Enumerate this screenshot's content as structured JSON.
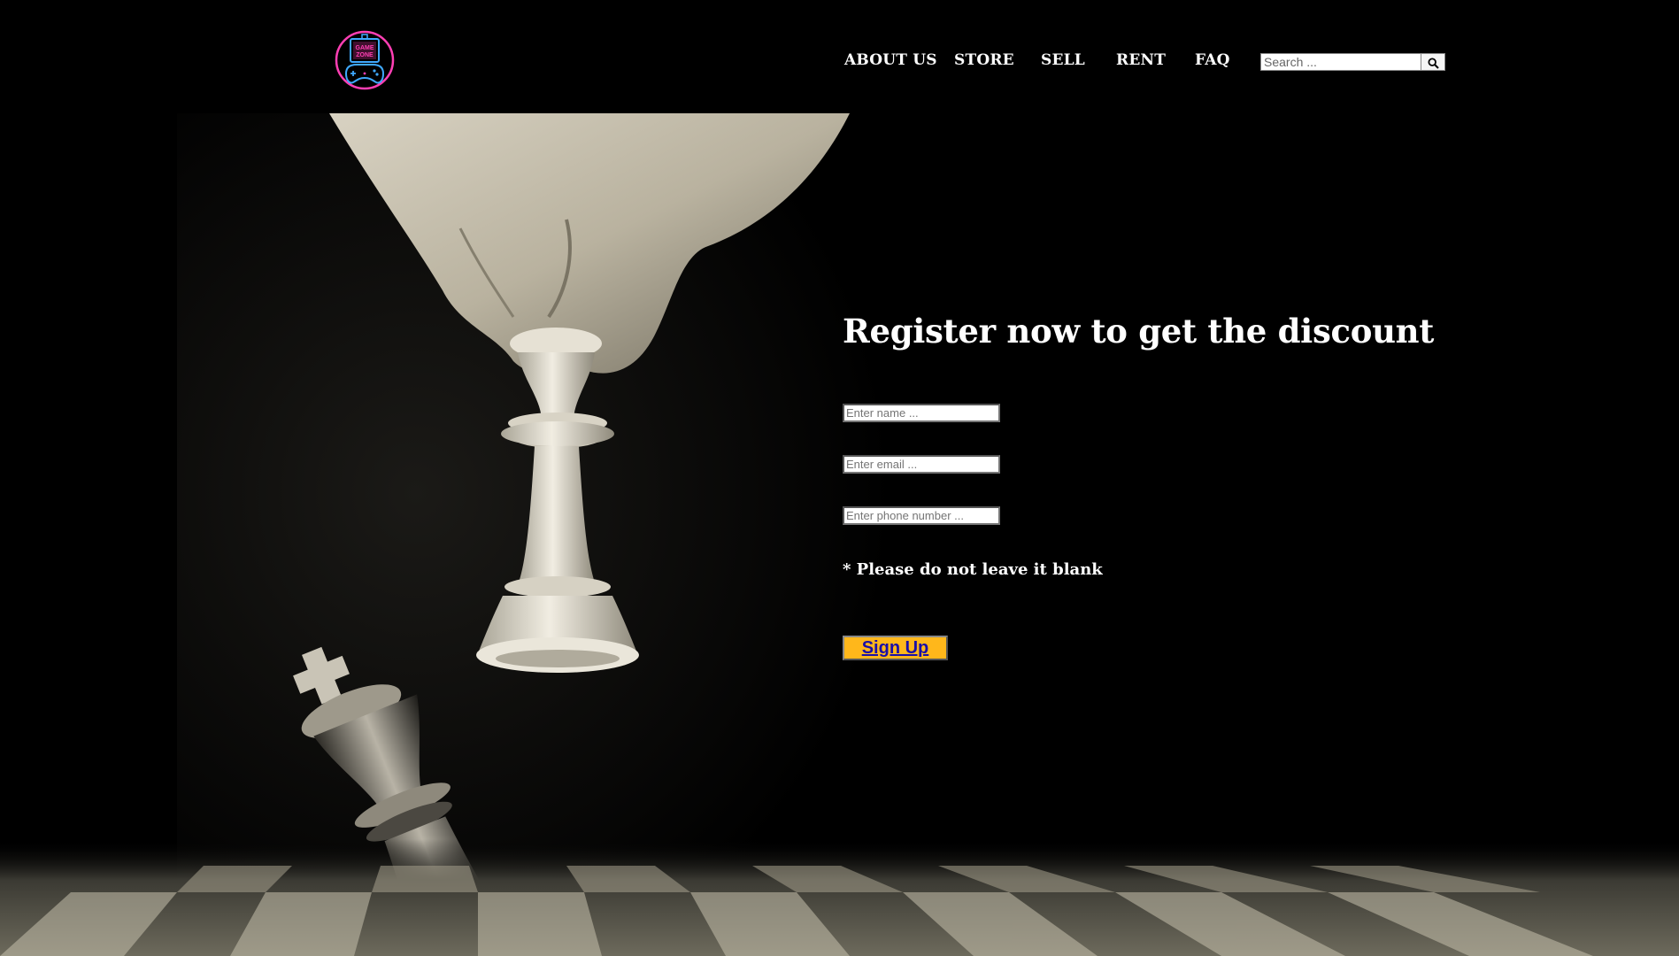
{
  "brand": {
    "logo_text_line1": "GAME",
    "logo_text_line2": "ZONE",
    "logo_ring_color": "#ff3fb4",
    "logo_controller_color": "#3fa9ff"
  },
  "nav": {
    "items": [
      {
        "label": "ABOUT US"
      },
      {
        "label": "STORE"
      },
      {
        "label": "SELL"
      },
      {
        "label": "RENT"
      },
      {
        "label": "FAQ"
      }
    ]
  },
  "search": {
    "placeholder": "Search ...",
    "button_icon": "search-icon"
  },
  "hero": {
    "image_subject": "chess-pieces-photo"
  },
  "register": {
    "title": "Register now to get the discount",
    "name_placeholder": "Enter name ...",
    "email_placeholder": "Enter email ...",
    "phone_placeholder": "Enter phone number ...",
    "note": "* Please do not leave it blank",
    "signup_label": "Sign Up",
    "signup_color": "#ffb71b",
    "signup_text_color": "#1a0fa8"
  }
}
